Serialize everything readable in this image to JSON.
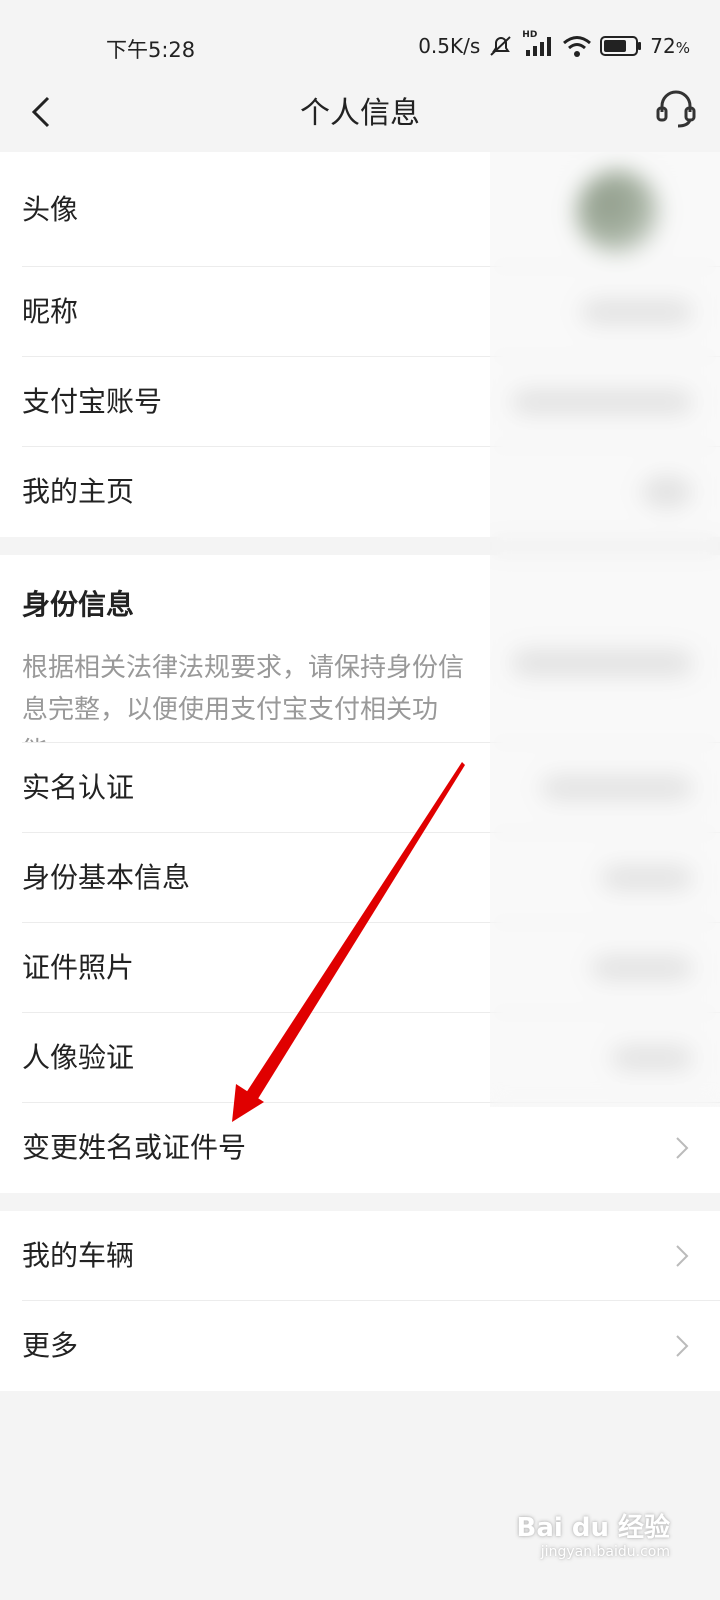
{
  "status_bar": {
    "time": "下午5:28",
    "network_speed": "0.5K/s",
    "battery": "72",
    "battery_unit": "%",
    "signal_tag": "HD"
  },
  "nav": {
    "title": "个人信息"
  },
  "profile_group": {
    "items": [
      {
        "label": "头像"
      },
      {
        "label": "昵称"
      },
      {
        "label": "支付宝账号"
      },
      {
        "label": "我的主页"
      }
    ]
  },
  "identity": {
    "title": "身份信息",
    "description": "根据相关法律法规要求，请保持身份信息完整，以便使用支付宝支付相关功能。",
    "items": [
      {
        "label": "实名认证"
      },
      {
        "label": "身份基本信息"
      },
      {
        "label": "证件照片"
      },
      {
        "label": "人像验证"
      },
      {
        "label": "变更姓名或证件号"
      }
    ]
  },
  "more_group": {
    "items": [
      {
        "label": "我的车辆"
      },
      {
        "label": "更多"
      }
    ]
  },
  "watermark": {
    "brand": "Bai du 经验",
    "url": "jingyan.baidu.com"
  },
  "colors": {
    "background": "#f4f4f4",
    "annotation_arrow": "#e00000",
    "muted_text": "#999999"
  }
}
